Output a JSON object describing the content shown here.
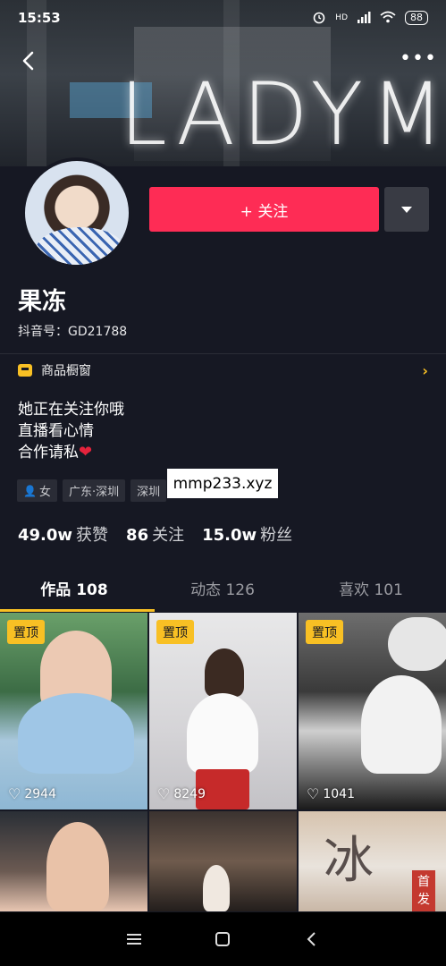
{
  "status_bar": {
    "time": "15:53",
    "network": "HD",
    "battery": "88"
  },
  "banner": {
    "sign_text": "LADYM"
  },
  "profile": {
    "follow_label": "+ 关注",
    "name": "果冻",
    "uid": "抖音号：GD21788",
    "shop_label": "商品橱窗",
    "bio_lines": [
      "她正在关注你哦",
      "直播看心情",
      "合作请私"
    ],
    "tags": [
      "女",
      "广东·深圳",
      "深圳"
    ],
    "stats": [
      {
        "value": "49.0w",
        "label": "获赞"
      },
      {
        "value": "86",
        "label": "关注"
      },
      {
        "value": "15.0w",
        "label": "粉丝"
      }
    ]
  },
  "overlay_watermark": "mmp233.xyz",
  "tabs": [
    {
      "label": "作品 108",
      "active": true
    },
    {
      "label": "动态 126",
      "active": false
    },
    {
      "label": "喜欢 101",
      "active": false
    }
  ],
  "videos": [
    {
      "pinned_label": "置顶",
      "likes": "2944"
    },
    {
      "pinned_label": "置顶",
      "likes": "8249"
    },
    {
      "pinned_label": "置顶",
      "likes": "1041"
    },
    {
      "likes": ""
    },
    {
      "likes": ""
    },
    {
      "cover_char": "冰",
      "stamp_text": "首发"
    }
  ],
  "colors": {
    "accent": "#fe2c55",
    "highlight": "#f8c024",
    "background": "#161823"
  },
  "icons": [
    "back-arrow-icon",
    "more-icon",
    "caret-down-icon",
    "shop-window-icon",
    "chevron-right-icon",
    "heart-icon",
    "female-icon",
    "menu-icon",
    "home-icon",
    "back-icon"
  ]
}
